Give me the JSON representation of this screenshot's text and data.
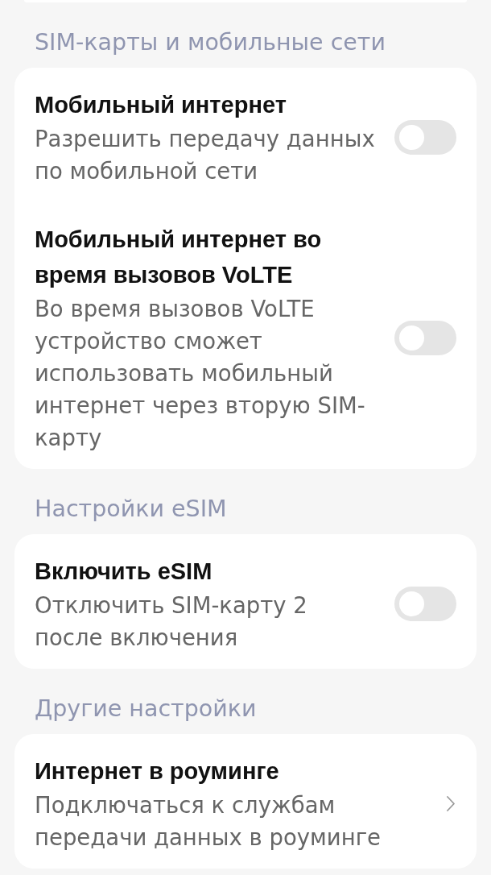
{
  "sections": [
    {
      "title": "SIM-карты и мобильные сети",
      "items": [
        {
          "kind": "toggle",
          "title": "Мобильный интернет",
          "description": "Разрешить передачу данных по мобильной сети",
          "on": false
        },
        {
          "kind": "toggle",
          "title": "Мобильный интернет во время вызовов VoLTE",
          "description": "Во время вызовов VoLTE устройство сможет использовать мобильный интернет через вторую SIM-карту",
          "on": false
        }
      ]
    },
    {
      "title": "Настройки eSIM",
      "items": [
        {
          "kind": "toggle",
          "title": "Включить eSIM",
          "description": "Отключить SIM-карту 2 после включения",
          "on": false
        }
      ]
    },
    {
      "title": "Другие настройки",
      "items": [
        {
          "kind": "link",
          "title": "Интернет в роуминге",
          "description": "Подключаться к службам передачи данных в роуминге"
        }
      ]
    }
  ]
}
